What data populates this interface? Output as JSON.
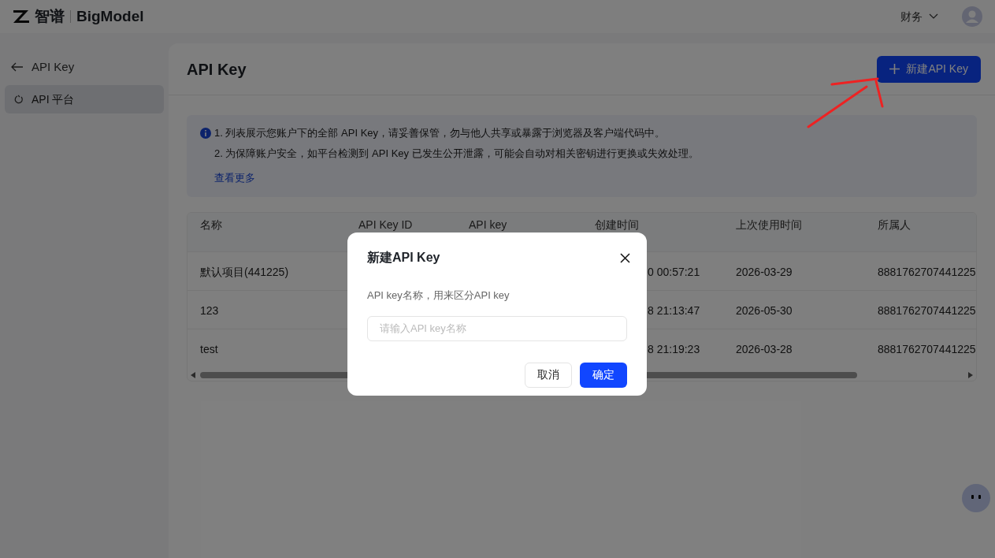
{
  "header": {
    "logo_text": "智谱",
    "brand": "BigModel",
    "menu": "财务"
  },
  "sidebar": {
    "back": "API Key",
    "items": [
      {
        "label": "API 平台",
        "selected": true
      }
    ]
  },
  "page": {
    "title": "API Key",
    "create_button": "新建API Key"
  },
  "notice": {
    "lines": [
      "1. 列表展示您账户下的全部 API Key，请妥善保管，勿与他人共享或暴露于浏览器及客户端代码中。",
      "2. 为保障账户安全，如平台检测到 API Key 已发生公开泄露，可能会自动对相关密钥进行更换或失效处理。"
    ],
    "link": "查看更多"
  },
  "table": {
    "columns": [
      "名称",
      "API Key ID",
      "API key",
      "创建时间",
      "上次使用时间",
      "所属人"
    ],
    "rows": [
      {
        "name": "默认项目(441225)",
        "created": "0 00:57:21",
        "last_used": "2026-03-29",
        "owner": "8881762707441225"
      },
      {
        "name": "123",
        "created": "8 21:13:47",
        "last_used": "2026-05-30",
        "owner": "8881762707441225"
      },
      {
        "name": "test",
        "created": "8 21:19:23",
        "last_used": "2026-03-28",
        "owner": "8881762707441225"
      }
    ]
  },
  "dialog": {
    "title": "新建API Key",
    "label": "API key名称，用来区分API key",
    "placeholder": "请输入API key名称",
    "cancel": "取消",
    "confirm": "确定"
  }
}
